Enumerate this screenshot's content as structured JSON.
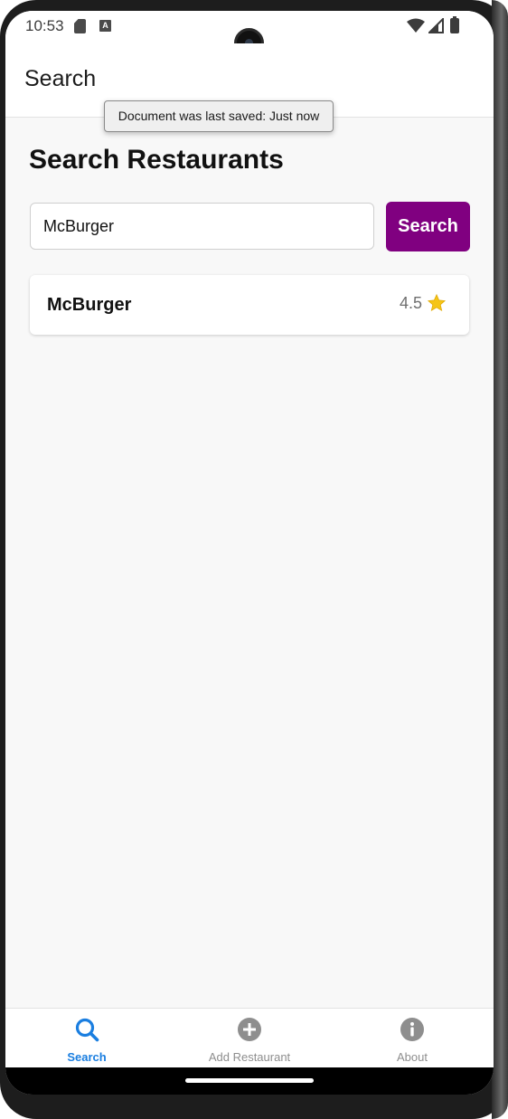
{
  "status_bar": {
    "time": "10:53",
    "icons": [
      "sd-card-icon",
      "keyboard-a-icon",
      "wifi-icon",
      "signal-icon",
      "battery-icon"
    ]
  },
  "header": {
    "title": "Search"
  },
  "tooltip": {
    "text": "Document was last saved: Just now"
  },
  "main": {
    "title": "Search Restaurants",
    "search": {
      "value": "McBurger",
      "button_label": "Search"
    },
    "results": [
      {
        "name": "McBurger",
        "rating": "4.5",
        "rating_icon": "star-icon"
      }
    ]
  },
  "tab_bar": {
    "tabs": [
      {
        "label": "Search",
        "icon": "search-icon",
        "active": true
      },
      {
        "label": "Add Restaurant",
        "icon": "plus-circle-icon",
        "active": false
      },
      {
        "label": "About",
        "icon": "info-circle-icon",
        "active": false
      }
    ]
  },
  "colors": {
    "accent": "#800080",
    "active_tab": "#1a7ee0",
    "inactive_tab": "#8e8e8e",
    "star": "#f5c518"
  }
}
